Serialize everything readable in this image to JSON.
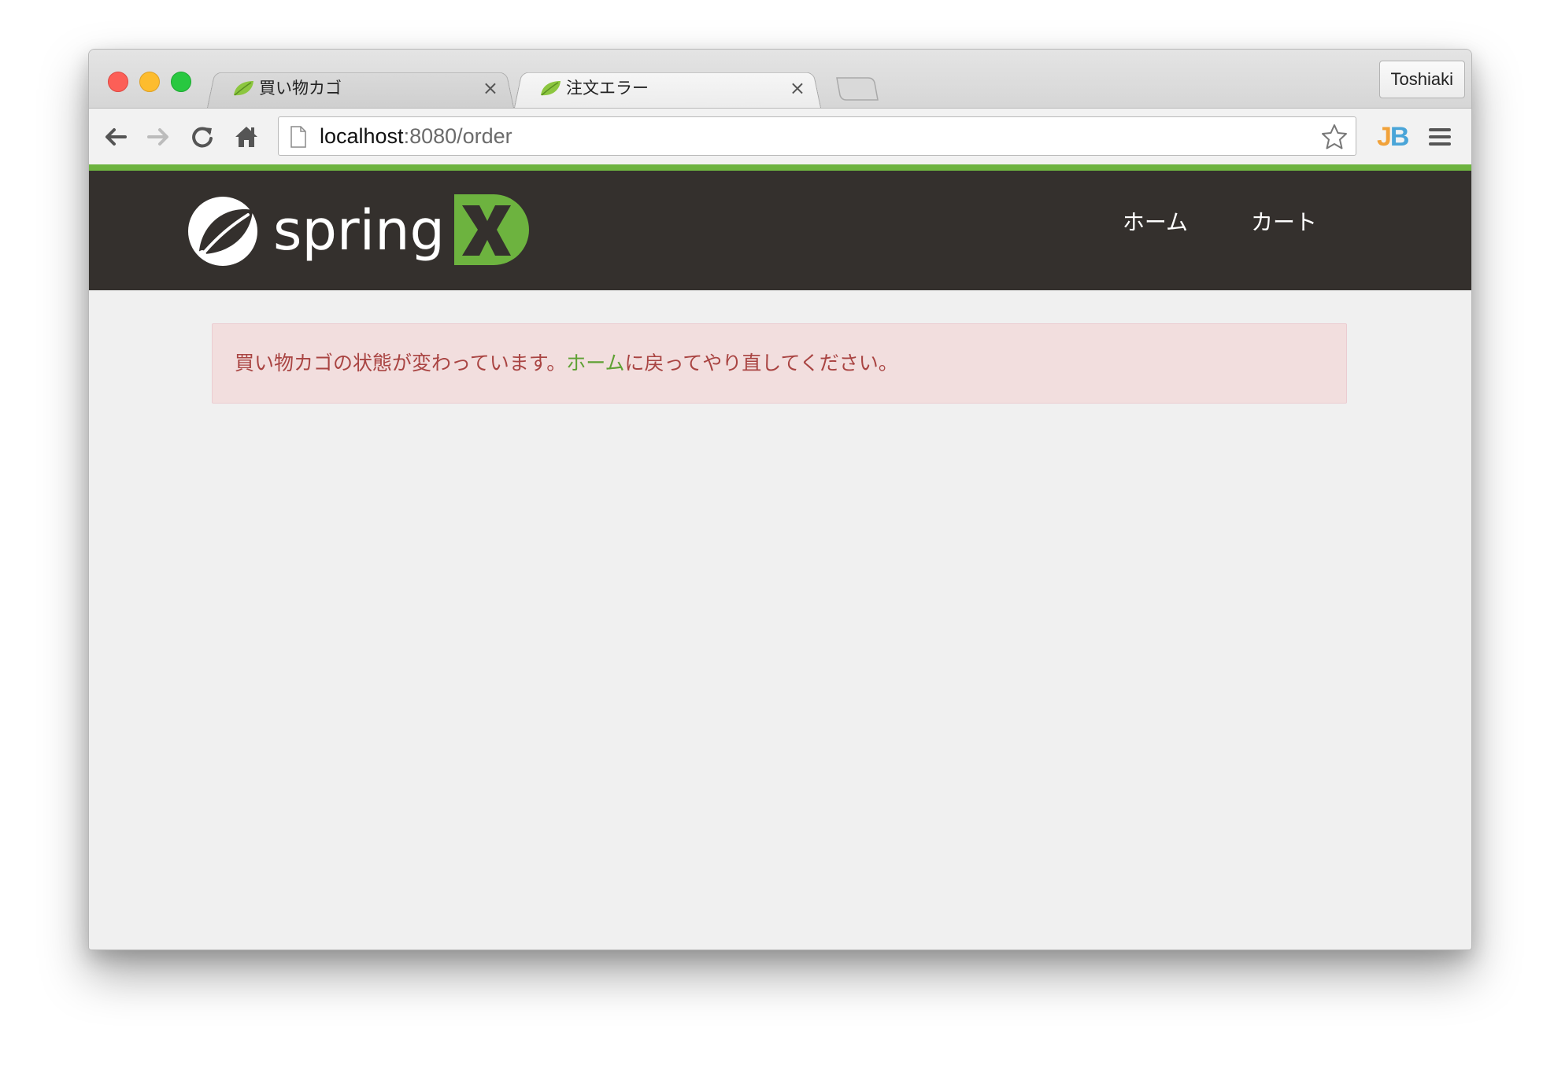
{
  "browser": {
    "tabs": [
      {
        "title": "買い物カゴ",
        "close": "×"
      },
      {
        "title": "注文エラー",
        "close": "×"
      }
    ],
    "profile_name": "Toshiaki",
    "address": {
      "host": "localhost",
      "rest": ":8080/order"
    },
    "extension_label_j": "J",
    "extension_label_b": "B"
  },
  "site": {
    "logo_text": "spring",
    "nav": [
      {
        "label": "ホーム"
      },
      {
        "label": "カート"
      }
    ]
  },
  "alert": {
    "before": "買い物カゴの状態が変わっています。",
    "link": "ホーム",
    "after": "に戻ってやり直してください。"
  },
  "colors": {
    "accent_green": "#6db33f",
    "header_bg": "#34302d",
    "alert_bg": "#f2dede",
    "alert_text": "#a94442"
  }
}
